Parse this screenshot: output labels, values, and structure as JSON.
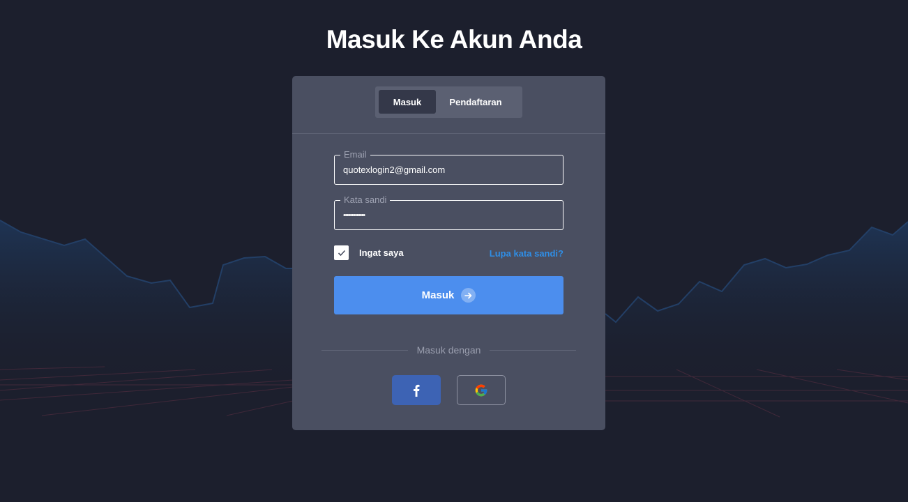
{
  "page": {
    "title": "Masuk Ke Akun Anda"
  },
  "tabs": {
    "login": "Masuk",
    "register": "Pendaftaran"
  },
  "form": {
    "email_label": "Email",
    "email_value": "quotexlogin2@gmail.com",
    "password_label": "Kata sandi",
    "password_value": "•••••••••••••",
    "remember_label": "Ingat saya",
    "remember_checked": true,
    "forgot_label": "Lupa kata sandi?",
    "submit_label": "Masuk"
  },
  "social": {
    "divider_label": "Masuk dengan",
    "buttons": [
      {
        "icon": "facebook-icon",
        "color": "#3d63b4"
      },
      {
        "icon": "google-icon"
      }
    ]
  },
  "colors": {
    "background": "#1c1f2d",
    "card": "#4a4f61",
    "accent": "#4c8eee",
    "link": "#2f8ee6"
  }
}
